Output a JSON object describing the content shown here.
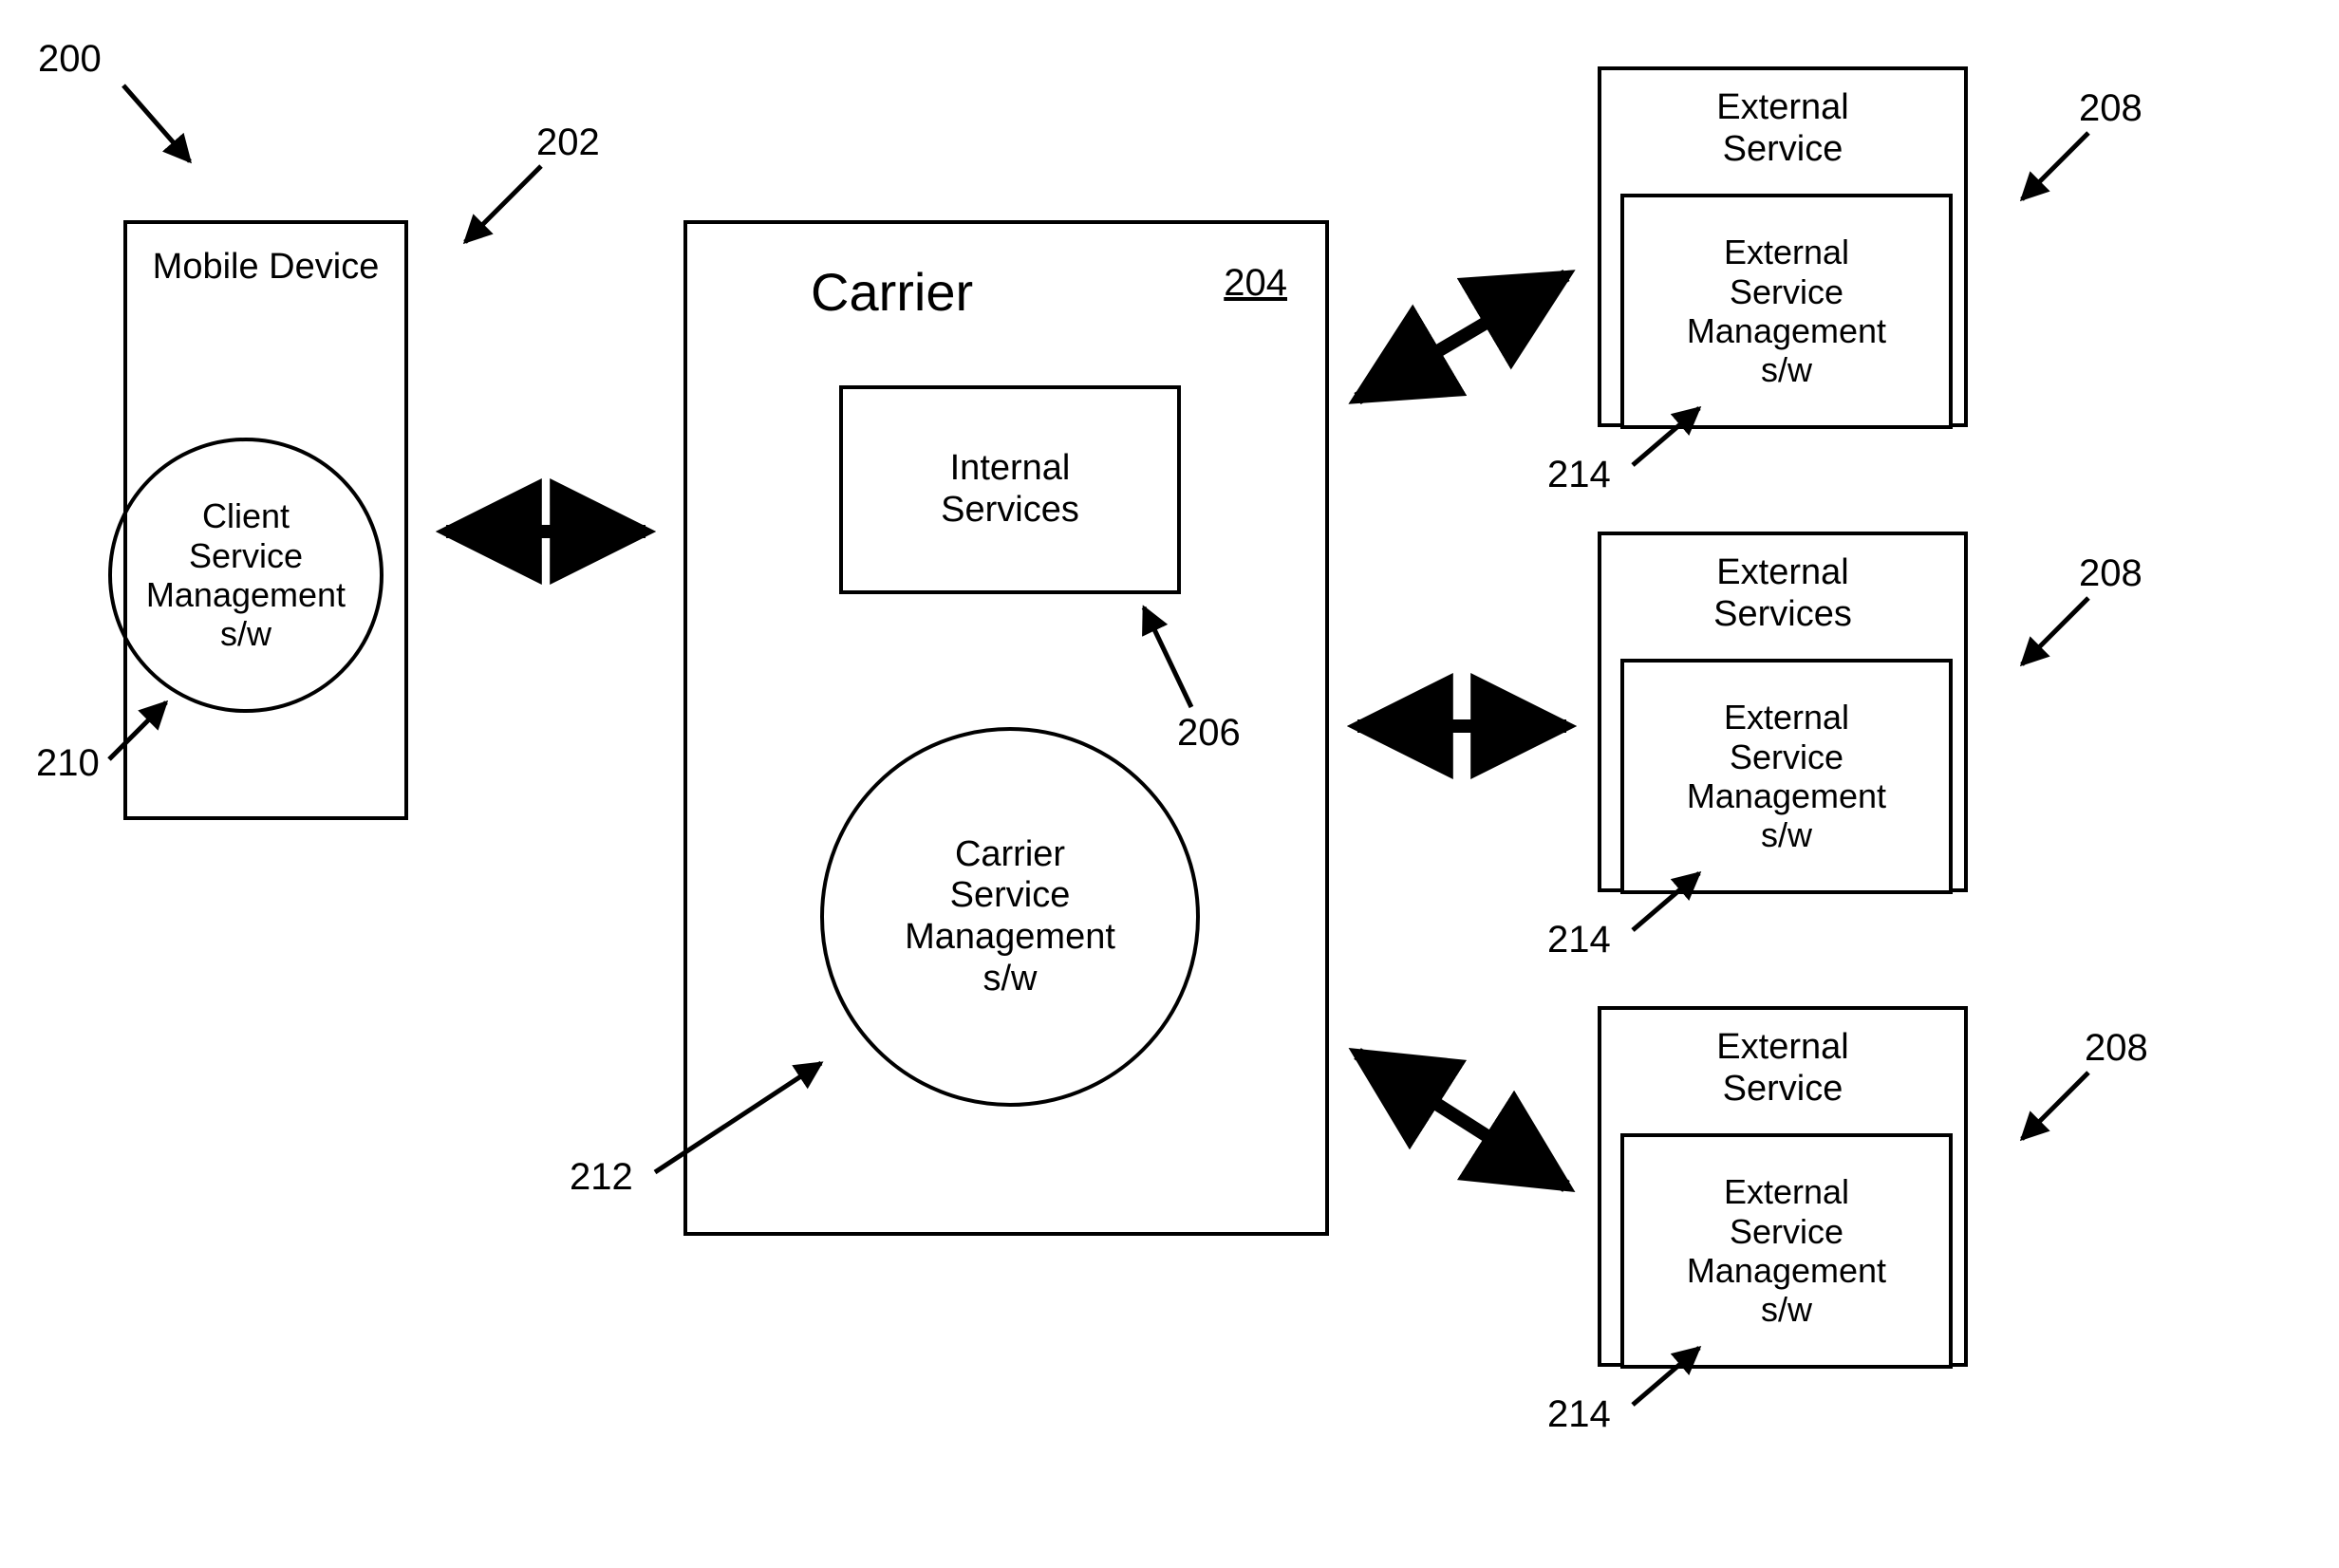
{
  "refs": {
    "r200": "200",
    "r202": "202",
    "r204": "204",
    "r206": "206",
    "r208a": "208",
    "r208b": "208",
    "r208c": "208",
    "r210": "210",
    "r212": "212",
    "r214a": "214",
    "r214b": "214",
    "r214c": "214"
  },
  "mobile": {
    "title": "Mobile Device",
    "clientLabel": "Client\nService\nManagement\ns/w"
  },
  "carrier": {
    "title": "Carrier",
    "id": "204",
    "internal": "Internal\nServices",
    "mgmtLabel": "Carrier\nService\nManagement\ns/w"
  },
  "ext": {
    "titleSingular": "External\nService",
    "titlePlural": "External\nServices",
    "mgmt": "External\nService\nManagement\ns/w"
  }
}
